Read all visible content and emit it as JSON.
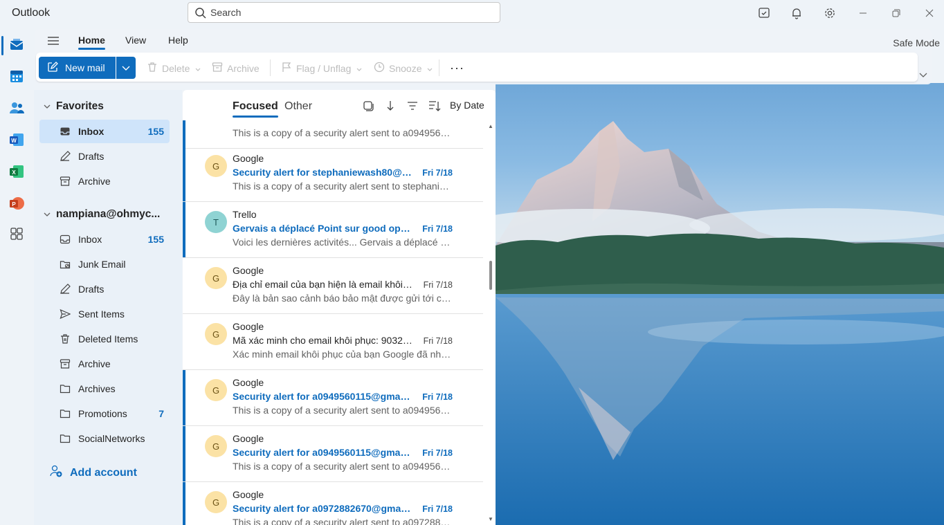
{
  "app": {
    "title": "Outlook",
    "search_placeholder": "Search"
  },
  "titlebar_icons": [
    "notes-icon",
    "bell-icon",
    "gear-icon",
    "minimize-icon",
    "restore-icon",
    "close-icon"
  ],
  "rail_apps": [
    "mail-icon",
    "calendar-icon",
    "people-icon",
    "word-icon",
    "excel-icon",
    "powerpoint-icon",
    "apps-icon"
  ],
  "ribbon": {
    "tabs": [
      "Home",
      "View",
      "Help"
    ],
    "active_tab": "Home",
    "safe_mode": "Safe Mode",
    "new_mail": "New mail",
    "delete": "Delete",
    "archive": "Archive",
    "flag": "Flag / Unflag",
    "snooze": "Snooze",
    "more": "···"
  },
  "folders": {
    "favorites_label": "Favorites",
    "favorites": [
      {
        "label": "Inbox",
        "count": "155"
      },
      {
        "label": "Drafts",
        "count": ""
      },
      {
        "label": "Archive",
        "count": ""
      }
    ],
    "account_label": "nampiana@ohmyc...",
    "account": [
      {
        "label": "Inbox",
        "count": "155"
      },
      {
        "label": "Junk Email",
        "count": ""
      },
      {
        "label": "Drafts",
        "count": ""
      },
      {
        "label": "Sent Items",
        "count": ""
      },
      {
        "label": "Deleted Items",
        "count": ""
      },
      {
        "label": "Archive",
        "count": ""
      },
      {
        "label": "Archives",
        "count": ""
      },
      {
        "label": "Promotions",
        "count": "7"
      },
      {
        "label": "SocialNetworks",
        "count": ""
      }
    ],
    "add_account": "Add account"
  },
  "list": {
    "focused": "Focused",
    "other": "Other",
    "sort_label": "By Date",
    "items": [
      {
        "sender": "",
        "avatar": "",
        "subject": "",
        "date": "",
        "preview": "This is a copy of a security alert sent to a0949560...",
        "unread": true
      },
      {
        "sender": "Google",
        "avatar": "G",
        "subject": "Security alert for stephaniewash80@g...",
        "date": "Fri 7/18",
        "preview": "This is a copy of a security alert sent to stephanie...",
        "unread": true
      },
      {
        "sender": "Trello",
        "avatar": "T",
        "subject": "Gervais a déplacé Point sur good opini...",
        "date": "Fri 7/18",
        "preview": "Voici les dernières activités... Gervais a déplacé Po...",
        "unread": true
      },
      {
        "sender": "Google",
        "avatar": "G",
        "subject": "Địa chỉ email của bạn hiện là email khôi ...",
        "date": "Fri 7/18",
        "preview": "Đây là bản sao cảnh báo bảo mật được gửi tới chi...",
        "unread": false
      },
      {
        "sender": "Google",
        "avatar": "G",
        "subject": "Mã xác minh cho email khôi phục: 903249",
        "date": "Fri 7/18",
        "preview": "Xác minh email khôi phục của bạn Google đã nhậ...",
        "unread": false
      },
      {
        "sender": "Google",
        "avatar": "G",
        "subject": "Security alert for a0949560115@gmail.c...",
        "date": "Fri 7/18",
        "preview": "This is a copy of a security alert sent to a0949560...",
        "unread": true
      },
      {
        "sender": "Google",
        "avatar": "G",
        "subject": "Security alert for a0949560115@gmail.c...",
        "date": "Fri 7/18",
        "preview": "This is a copy of a security alert sent to a0949560...",
        "unread": true
      },
      {
        "sender": "Google",
        "avatar": "G",
        "subject": "Security alert for a0972882670@gmail....",
        "date": "Fri 7/18",
        "preview": "This is a copy of a security alert sent to a0972882...",
        "unread": true
      }
    ]
  },
  "colors": {
    "accent": "#0f6cbd",
    "pane": "#eaf1f8",
    "selected": "#cfe4fa"
  }
}
